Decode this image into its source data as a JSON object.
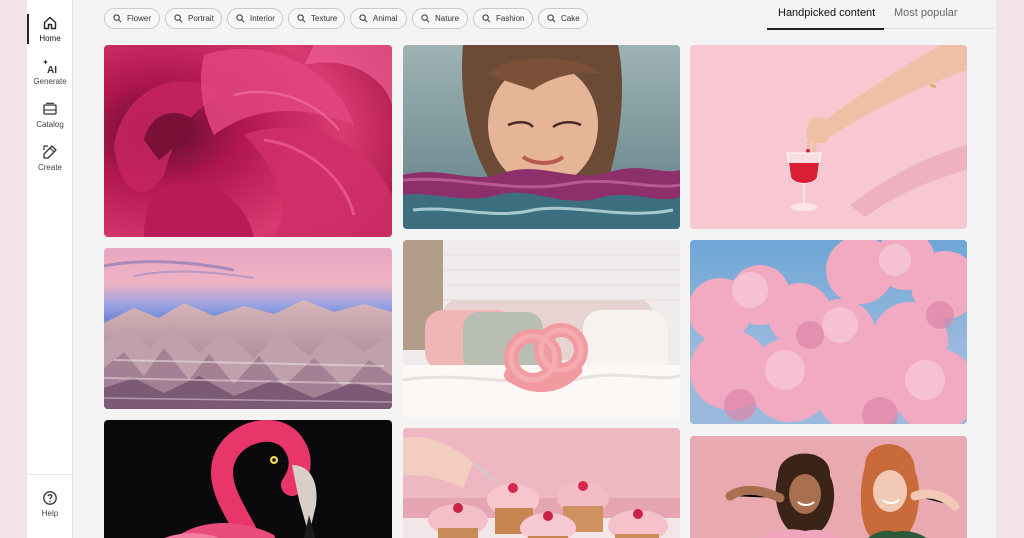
{
  "sidebar": {
    "items": [
      {
        "label": "Home",
        "icon": "home-icon"
      },
      {
        "label": "Generate",
        "icon": "ai-sparkle-icon"
      },
      {
        "label": "Catalog",
        "icon": "catalog-icon"
      },
      {
        "label": "Create",
        "icon": "create-icon"
      }
    ],
    "help": {
      "label": "Help",
      "icon": "help-icon"
    }
  },
  "filters": [
    "Flower",
    "Portrait",
    "Interior",
    "Texture",
    "Animal",
    "Nature",
    "Fashion",
    "Cake"
  ],
  "tabs": {
    "handpicked": "Handpicked content",
    "popular": "Most popular"
  },
  "gallery": [
    {
      "subject": "pink peony flower close-up"
    },
    {
      "subject": "portrait of woman through rippling water"
    },
    {
      "subject": "hand holding glass of red wine on pink background"
    },
    {
      "subject": "badlands mountains under purple and pink sky"
    },
    {
      "subject": "pink knot pillow on bed"
    },
    {
      "subject": "pink clouds in blue sky"
    },
    {
      "subject": "pink flamingo on black background"
    },
    {
      "subject": "pink cupcakes with raspberries"
    },
    {
      "subject": "two women making peace sign on pink background"
    }
  ],
  "colors": {
    "accent": "#222222",
    "background": "#f4f4f5",
    "page_margin": "#f2e4e6"
  }
}
